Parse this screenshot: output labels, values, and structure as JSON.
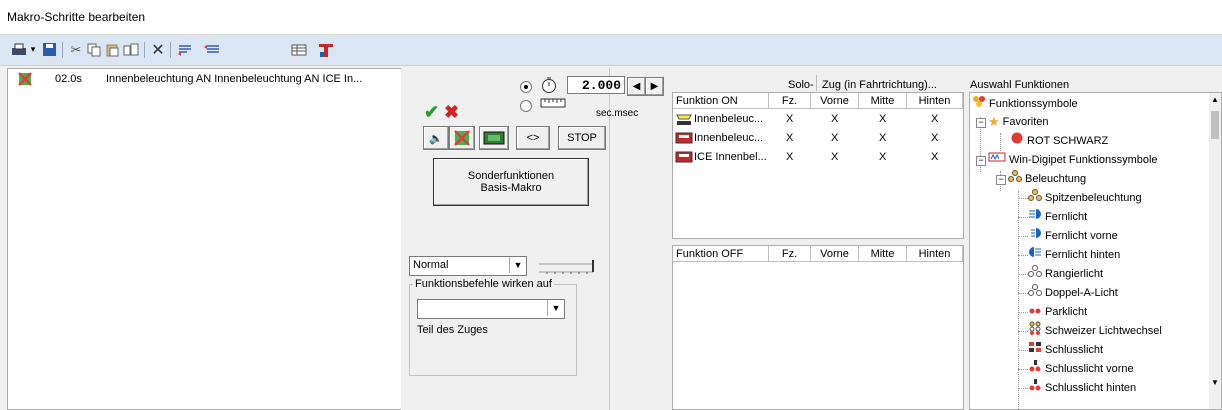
{
  "window": {
    "title": "Makro-Schritte bearbeiten"
  },
  "macro_list": [
    {
      "time": "02.0s",
      "text": "Innenbeleuchtung AN Innenbeleuchtung AN ICE In..."
    }
  ],
  "timing": {
    "value": "2.000",
    "unit_label": "sec.msec"
  },
  "buttons": {
    "stop": "STOP",
    "arrows": "<>",
    "sonder_line1": "Sonderfunktionen",
    "sonder_line2": "Basis-Makro"
  },
  "mode_select": {
    "value": "Normal"
  },
  "funktionsbefehle": {
    "legend": "Funktionsbefehle wirken auf",
    "value": "",
    "note": "Teil des Zuges"
  },
  "on_table": {
    "group_header_solo": "Solo-",
    "group_header_zug": "Zug (in Fahrtrichtung)...",
    "columns": [
      "Funktion ON",
      "Fz.",
      "Vorne",
      "Mitte",
      "Hinten"
    ],
    "rows": [
      {
        "name": "Innenbeleuc...",
        "fz": "X",
        "vorne": "X",
        "mitte": "X",
        "hinten": "X"
      },
      {
        "name": "Innenbeleuc...",
        "fz": "X",
        "vorne": "X",
        "mitte": "X",
        "hinten": "X"
      },
      {
        "name": "ICE Innenbel...",
        "fz": "X",
        "vorne": "X",
        "mitte": "X",
        "hinten": "X"
      }
    ]
  },
  "off_table": {
    "columns": [
      "Funktion OFF",
      "Fz.",
      "Vorne",
      "Mitte",
      "Hinten"
    ]
  },
  "tree": {
    "header": "Auswahl Funktionen",
    "root": "Funktionssymbole",
    "favoriten": "Favoriten",
    "rot_schwarz": "ROT SCHWARZ",
    "win_digipet": "Win-Digipet Funktionssymbole",
    "beleuchtung": "Beleuchtung",
    "items": [
      "Spitzenbeleuchtung",
      "Fernlicht",
      "Fernlicht vorne",
      "Fernlicht hinten",
      "Rangierlicht",
      "Doppel-A-Licht",
      "Parklicht",
      "Schweizer Lichtwechsel",
      "Schlusslicht",
      "Schlusslicht vorne",
      "Schlusslicht hinten"
    ]
  },
  "colors": {
    "toolbar_bg": "#dbe6f4",
    "accept_green": "#2e9a2e",
    "cancel_red": "#d42020"
  }
}
